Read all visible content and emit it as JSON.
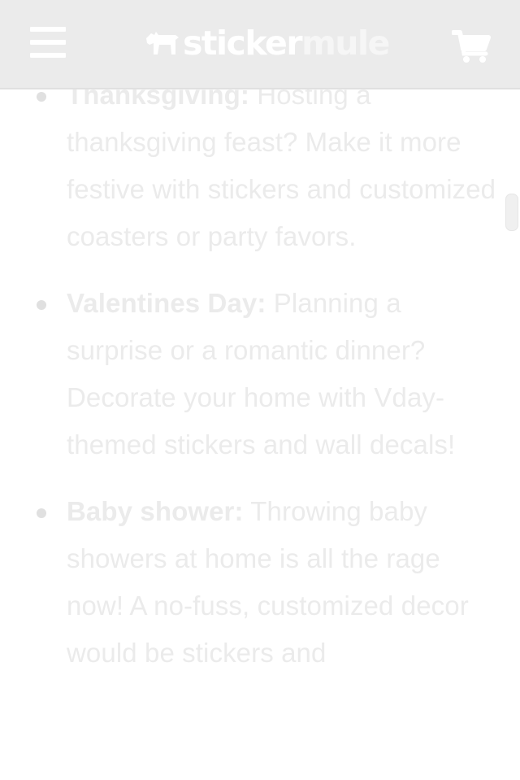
{
  "header": {
    "logo_part1": "sticker",
    "logo_part2": "mule",
    "menu_icon": "hamburger-menu-icon",
    "cart_icon": "shopping-cart-icon",
    "background_color": "#ebebeb"
  },
  "article": {
    "items": [
      {
        "term": "Thanksgiving:",
        "text": " Hosting a thanksgiving feast? Make it more festive with stickers and customized coasters or party favors."
      },
      {
        "term": "Valentines Day:",
        "text": " Planning a surprise or a romantic dinner? Decorate your home with Vday-themed stickers and wall decals!"
      },
      {
        "term": "Baby shower:",
        "text": " Throwing baby showers at home is all the rage now! A no-fuss, customized decor would be stickers and"
      }
    ]
  }
}
